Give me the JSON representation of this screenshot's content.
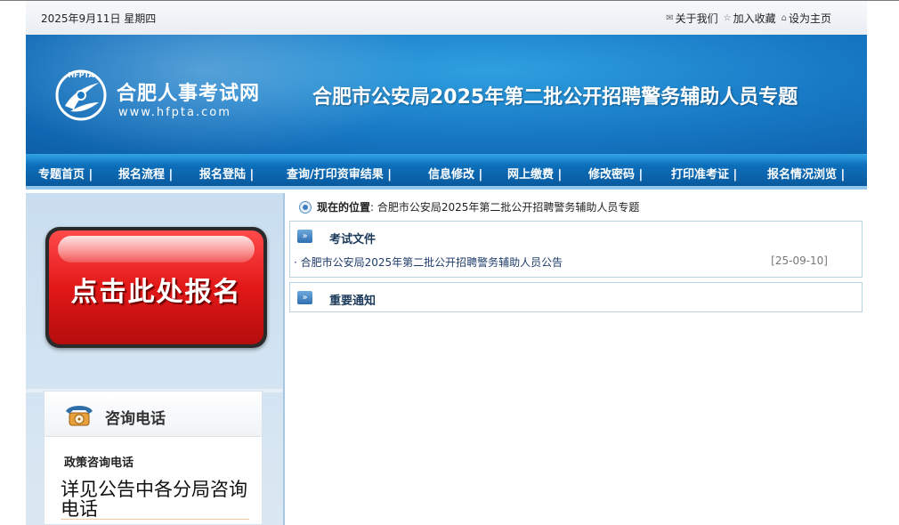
{
  "topbar": {
    "date": "2025年9月11日 星期四",
    "links": [
      {
        "icon": "mail-icon",
        "label": "关于我们"
      },
      {
        "icon": "star-icon",
        "label": "加入收藏"
      },
      {
        "icon": "home-icon",
        "label": "设为主页"
      }
    ]
  },
  "banner": {
    "logo_letters": "HFPTA",
    "site_name": "合肥人事考试网",
    "site_url": "www.hfpta.com",
    "title": "合肥市公安局2025年第二批公开招聘警务辅助人员专题"
  },
  "nav": {
    "items": [
      "专题首页 |",
      "报名流程 |",
      "报名登陆 |",
      "查询/打印资审结果 |",
      "信息修改 |",
      "网上缴费 |",
      "修改密码 |",
      "打印准考证 |",
      "报名情况浏览 |"
    ]
  },
  "register": {
    "label": "点击此处报名"
  },
  "contact": {
    "title": "咨询电话",
    "policy_label": "政策咨询电话",
    "detail": "详见公告中各分局咨询电话"
  },
  "breadcrumb": {
    "label": "现在的位置",
    "path": ": 合肥市公安局2025年第二批公开招聘警务辅助人员专题"
  },
  "sections": {
    "exam_files": {
      "title": "考试文件",
      "items": [
        {
          "title": "· 合肥市公安局2025年第二批公开招聘警务辅助人员公告",
          "date": "[25-09-10]"
        }
      ]
    },
    "notices": {
      "title": "重要通知"
    }
  }
}
